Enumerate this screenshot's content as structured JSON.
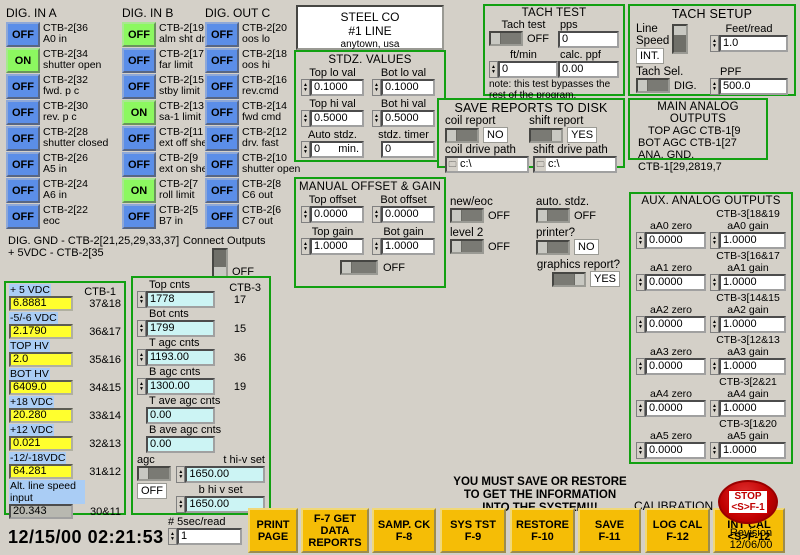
{
  "colors": {
    "panel_bg": "#d4d0c8",
    "group_border": "#12a012",
    "led_off": "#5b8ee8",
    "led_on": "#8cf860",
    "value_yellow": "#ffff2e",
    "value_cyan": "#ccf4f4",
    "button_gold": "#f5bd06",
    "stop_red": "#c00000"
  },
  "dig_in_a": {
    "header": "DIG. IN A",
    "rows": [
      {
        "state": "OFF",
        "on": false,
        "terminal": "CTB-2[36",
        "desc": "A0 in"
      },
      {
        "state": "ON",
        "on": true,
        "terminal": "CTB-2[34",
        "desc": "shutter open"
      },
      {
        "state": "OFF",
        "on": false,
        "terminal": "CTB-2[32",
        "desc": "fwd. p c"
      },
      {
        "state": "OFF",
        "on": false,
        "terminal": "CTB-2[30",
        "desc": "rev. p c"
      },
      {
        "state": "OFF",
        "on": false,
        "terminal": "CTB-2[28",
        "desc": "shutter closed"
      },
      {
        "state": "OFF",
        "on": false,
        "terminal": "CTB-2[26",
        "desc": "A5 in"
      },
      {
        "state": "OFF",
        "on": false,
        "terminal": "CTB-2[24",
        "desc": "A6 in"
      },
      {
        "state": "OFF",
        "on": false,
        "terminal": "CTB-2[22",
        "desc": "eoc"
      }
    ]
  },
  "dig_in_b": {
    "header": "DIG. IN B",
    "rows": [
      {
        "state": "OFF",
        "on": true,
        "terminal": "CTB-2[19",
        "desc": "alm sht dn."
      },
      {
        "state": "OFF",
        "on": false,
        "terminal": "CTB-2[17",
        "desc": "far limit"
      },
      {
        "state": "OFF",
        "on": false,
        "terminal": "CTB-2[15",
        "desc": "stby limit"
      },
      {
        "state": "ON",
        "on": true,
        "terminal": "CTB-2[13",
        "desc": "sa-1 limit"
      },
      {
        "state": "OFF",
        "on": false,
        "terminal": "CTB-2[11",
        "desc": "ext off sheet"
      },
      {
        "state": "OFF",
        "on": false,
        "terminal": "CTB-2[9",
        "desc": "ext on sheet"
      },
      {
        "state": "ON",
        "on": true,
        "terminal": "CTB-2[7",
        "desc": "roll limit"
      },
      {
        "state": "OFF",
        "on": false,
        "terminal": "CTB-2[5",
        "desc": "B7 in"
      }
    ]
  },
  "dig_out_c": {
    "header": "DIG. OUT C",
    "rows": [
      {
        "state": "OFF",
        "on": false,
        "terminal": "CTB-2[20",
        "desc": "oos lo"
      },
      {
        "state": "OFF",
        "on": false,
        "terminal": "CTB-2[18",
        "desc": "oos hi"
      },
      {
        "state": "OFF",
        "on": false,
        "terminal": "CTB-2[16",
        "desc": "rev.cmd"
      },
      {
        "state": "OFF",
        "on": false,
        "terminal": "CTB-2[14",
        "desc": "fwd cmd"
      },
      {
        "state": "OFF",
        "on": false,
        "terminal": "CTB-2[12",
        "desc": "drv. fast"
      },
      {
        "state": "OFF",
        "on": false,
        "terminal": "CTB-2[10",
        "desc": "shutter open"
      },
      {
        "state": "OFF",
        "on": false,
        "terminal": "CTB-2[8",
        "desc": "C6 out"
      },
      {
        "state": "OFF",
        "on": false,
        "terminal": "CTB-2[6",
        "desc": "C7 out"
      }
    ]
  },
  "grounding": {
    "line1": "DIG. GND - CTB-2[21,25,29,33,37]",
    "line2": "+ 5VDC - CTB-2[35",
    "connect_outputs_label": "Connect Outputs",
    "connect_outputs_value": "OFF"
  },
  "banner": {
    "line1": "STEEL CO",
    "line2": "#1 LINE",
    "line3": "anytown, usa"
  },
  "stdz_values": {
    "title": "STDZ. VALUES",
    "top_lo_label": "Top lo val",
    "top_lo_value": "0.1000",
    "bot_lo_label": "Bot lo val",
    "bot_lo_value": "0.1000",
    "top_hi_label": "Top hi val",
    "top_hi_value": "0.5000",
    "bot_hi_label": "Bot hi val",
    "bot_hi_value": "0.5000",
    "auto_stdz_label": "Auto stdz.",
    "auto_stdz_value": "0",
    "auto_stdz_units": "min.",
    "stdz_timer_label": "stdz. timer",
    "stdz_timer_value": "0"
  },
  "manual_offset_gain": {
    "title": "MANUAL OFFSET & GAIN",
    "top_offset_label": "Top offset",
    "top_offset_value": "0.0000",
    "bot_offset_label": "Bot offset",
    "bot_offset_value": "0.0000",
    "top_gain_label": "Top gain",
    "top_gain_value": "1.0000",
    "bot_gain_label": "Bot gain",
    "bot_gain_value": "1.0000",
    "enable_value": "OFF"
  },
  "tach_test": {
    "title": "TACH TEST",
    "tach_test_label": "Tach test",
    "tach_test_value": "OFF",
    "pps_label": "pps",
    "pps_value": "0",
    "ftmin_label": "ft/min",
    "ftmin_value": "0",
    "calc_ppf_label": "calc. ppf",
    "calc_ppf_value": "0.00",
    "note1": "note: this test bypasses the",
    "note2": "rest of the program."
  },
  "tach_setup": {
    "title": "TACH SETUP",
    "line_speed_label1": "Line",
    "line_speed_label2": "Speed",
    "line_speed_value": "INT.",
    "feet_read_label": "Feet/read",
    "feet_read_value": "1.0",
    "tach_sel_label": "Tach Sel.",
    "tach_sel_value": "DIG.",
    "ppf_label": "PPF",
    "ppf_value": "500.0"
  },
  "save_reports": {
    "title": "SAVE REPORTS TO DISK",
    "coil_report_label": "coil report",
    "coil_report_value": "NO",
    "shift_report_label": "shift report",
    "shift_report_value": "YES",
    "coil_path_label": "coil drive path",
    "coil_path_value": "c:\\",
    "shift_path_label": "shift drive path",
    "shift_path_value": "c:\\"
  },
  "main_analog_outputs": {
    "title": "MAIN ANALOG OUTPUTS",
    "lines": [
      "TOP AGC CTB-1[9",
      "BOT AGC CTB-1[27",
      "ANA. GND.",
      "CTB-1[29,2819,7"
    ]
  },
  "toggles": {
    "new_eoc_label": "new/eoc",
    "new_eoc_value": "OFF",
    "auto_stdz_label": "auto. stdz.",
    "auto_stdz_value": "OFF",
    "level2_label": "level 2",
    "level2_value": "OFF",
    "printer_label": "printer?",
    "printer_value": "NO",
    "graphics_label": "graphics report?",
    "graphics_value": "YES"
  },
  "aux_analog_outputs": {
    "title": "AUX. ANALOG OUTPUTS",
    "rows": [
      {
        "zero_label": "aA0 zero",
        "zero_value": "0.0000",
        "terminal": "CTB-3[18&19",
        "gain_label": "aA0 gain",
        "gain_value": "1.0000"
      },
      {
        "zero_label": "aA1 zero",
        "zero_value": "0.0000",
        "terminal": "CTB-3[16&17",
        "gain_label": "aA1 gain",
        "gain_value": "1.0000"
      },
      {
        "zero_label": "aA2 zero",
        "zero_value": "0.0000",
        "terminal": "CTB-3[14&15",
        "gain_label": "aA2 gain",
        "gain_value": "1.0000"
      },
      {
        "zero_label": "aA3 zero",
        "zero_value": "0.0000",
        "terminal": "CTB-3[12&13",
        "gain_label": "aA3 gain",
        "gain_value": "1.0000"
      },
      {
        "zero_label": "aA4 zero",
        "zero_value": "0.0000",
        "terminal": "CTB-3[2&21",
        "gain_label": "aA4 gain",
        "gain_value": "1.0000"
      },
      {
        "zero_label": "aA5 zero",
        "zero_value": "0.0000",
        "terminal": "CTB-3[1&20",
        "gain_label": "aA5 gain",
        "gain_value": "1.0000"
      }
    ]
  },
  "ctb1_voltages": {
    "column_header": "CTB-1",
    "rows": [
      {
        "label": "+ 5 VDC",
        "value": "6.8881",
        "terminal": "37&18",
        "style": "yellow"
      },
      {
        "label": "-5/-6 VDC",
        "value": "2.1790",
        "terminal": "36&17",
        "style": "yellow"
      },
      {
        "label": "TOP HV",
        "value": "2.0",
        "terminal": "35&16",
        "style": "yellow"
      },
      {
        "label": "BOT HV",
        "value": "6409.0",
        "terminal": "34&15",
        "style": "yellow"
      },
      {
        "label": "+18 VDC",
        "value": "20.280",
        "terminal": "33&14",
        "style": "yellow"
      },
      {
        "label": "+12 VDC",
        "value": "0.021",
        "terminal": "32&13",
        "style": "yellow"
      },
      {
        "label": "-12/-18VDC",
        "value": "64.281",
        "terminal": "31&12",
        "style": "yellow"
      },
      {
        "label": "Alt. line speed input",
        "value": "20.343",
        "terminal": "30&11",
        "style": "gray"
      }
    ]
  },
  "ctb3_counts": {
    "column_header": "CTB-3",
    "rows": [
      {
        "label": "Top cnts",
        "value": "1778",
        "terminal": "17",
        "spin": true
      },
      {
        "label": "Bot cnts",
        "value": "1799",
        "terminal": "15",
        "spin": true
      },
      {
        "label": "T agc cnts",
        "value": "1193.00",
        "terminal": "36",
        "spin": true
      },
      {
        "label": "B agc cnts",
        "value": "1300.00",
        "terminal": "19",
        "spin": true
      },
      {
        "label": "T ave agc cnts",
        "value": "0.00",
        "terminal": "",
        "spin": false
      },
      {
        "label": "B ave agc cnts",
        "value": "0.00",
        "terminal": "",
        "spin": false
      }
    ],
    "agc_label": "agc",
    "agc_value": "OFF",
    "t_hiv_label": "t hi-v set",
    "t_hiv_value": "1650.00",
    "b_hiv_label": "b hi v set",
    "b_hiv_value": "1650.00"
  },
  "status": {
    "datetime": "12/15/00 02:21:53",
    "sample_label": "# 5sec/read",
    "sample_value": "1",
    "warning_line1": "YOU MUST SAVE OR RESTORE",
    "warning_line2": "TO GET THE INFORMATION",
    "warning_line3": "INTO THE SYSTEM!!!",
    "calibration_label": "CALIBRATION",
    "revision_label": "Revision",
    "revision_value": "12/06/00"
  },
  "function_buttons": [
    {
      "line1": "PRINT",
      "line2": "PAGE",
      "line3": ""
    },
    {
      "line1": "F-7 GET",
      "line2": "DATA",
      "line3": "REPORTS"
    },
    {
      "line1": "SAMP. CK",
      "line2": "F-8",
      "line3": ""
    },
    {
      "line1": "SYS TST",
      "line2": "F-9",
      "line3": ""
    },
    {
      "line1": "RESTORE",
      "line2": "F-10",
      "line3": ""
    },
    {
      "line1": "SAVE",
      "line2": "F-11",
      "line3": ""
    },
    {
      "line1": "LOG CAL",
      "line2": "F-12",
      "line3": ""
    },
    {
      "line1": "INT CAL",
      "line2": "<S>F-12",
      "line3": ""
    }
  ],
  "stop_button": {
    "line1": "STOP",
    "line2": "<S>F-1"
  }
}
